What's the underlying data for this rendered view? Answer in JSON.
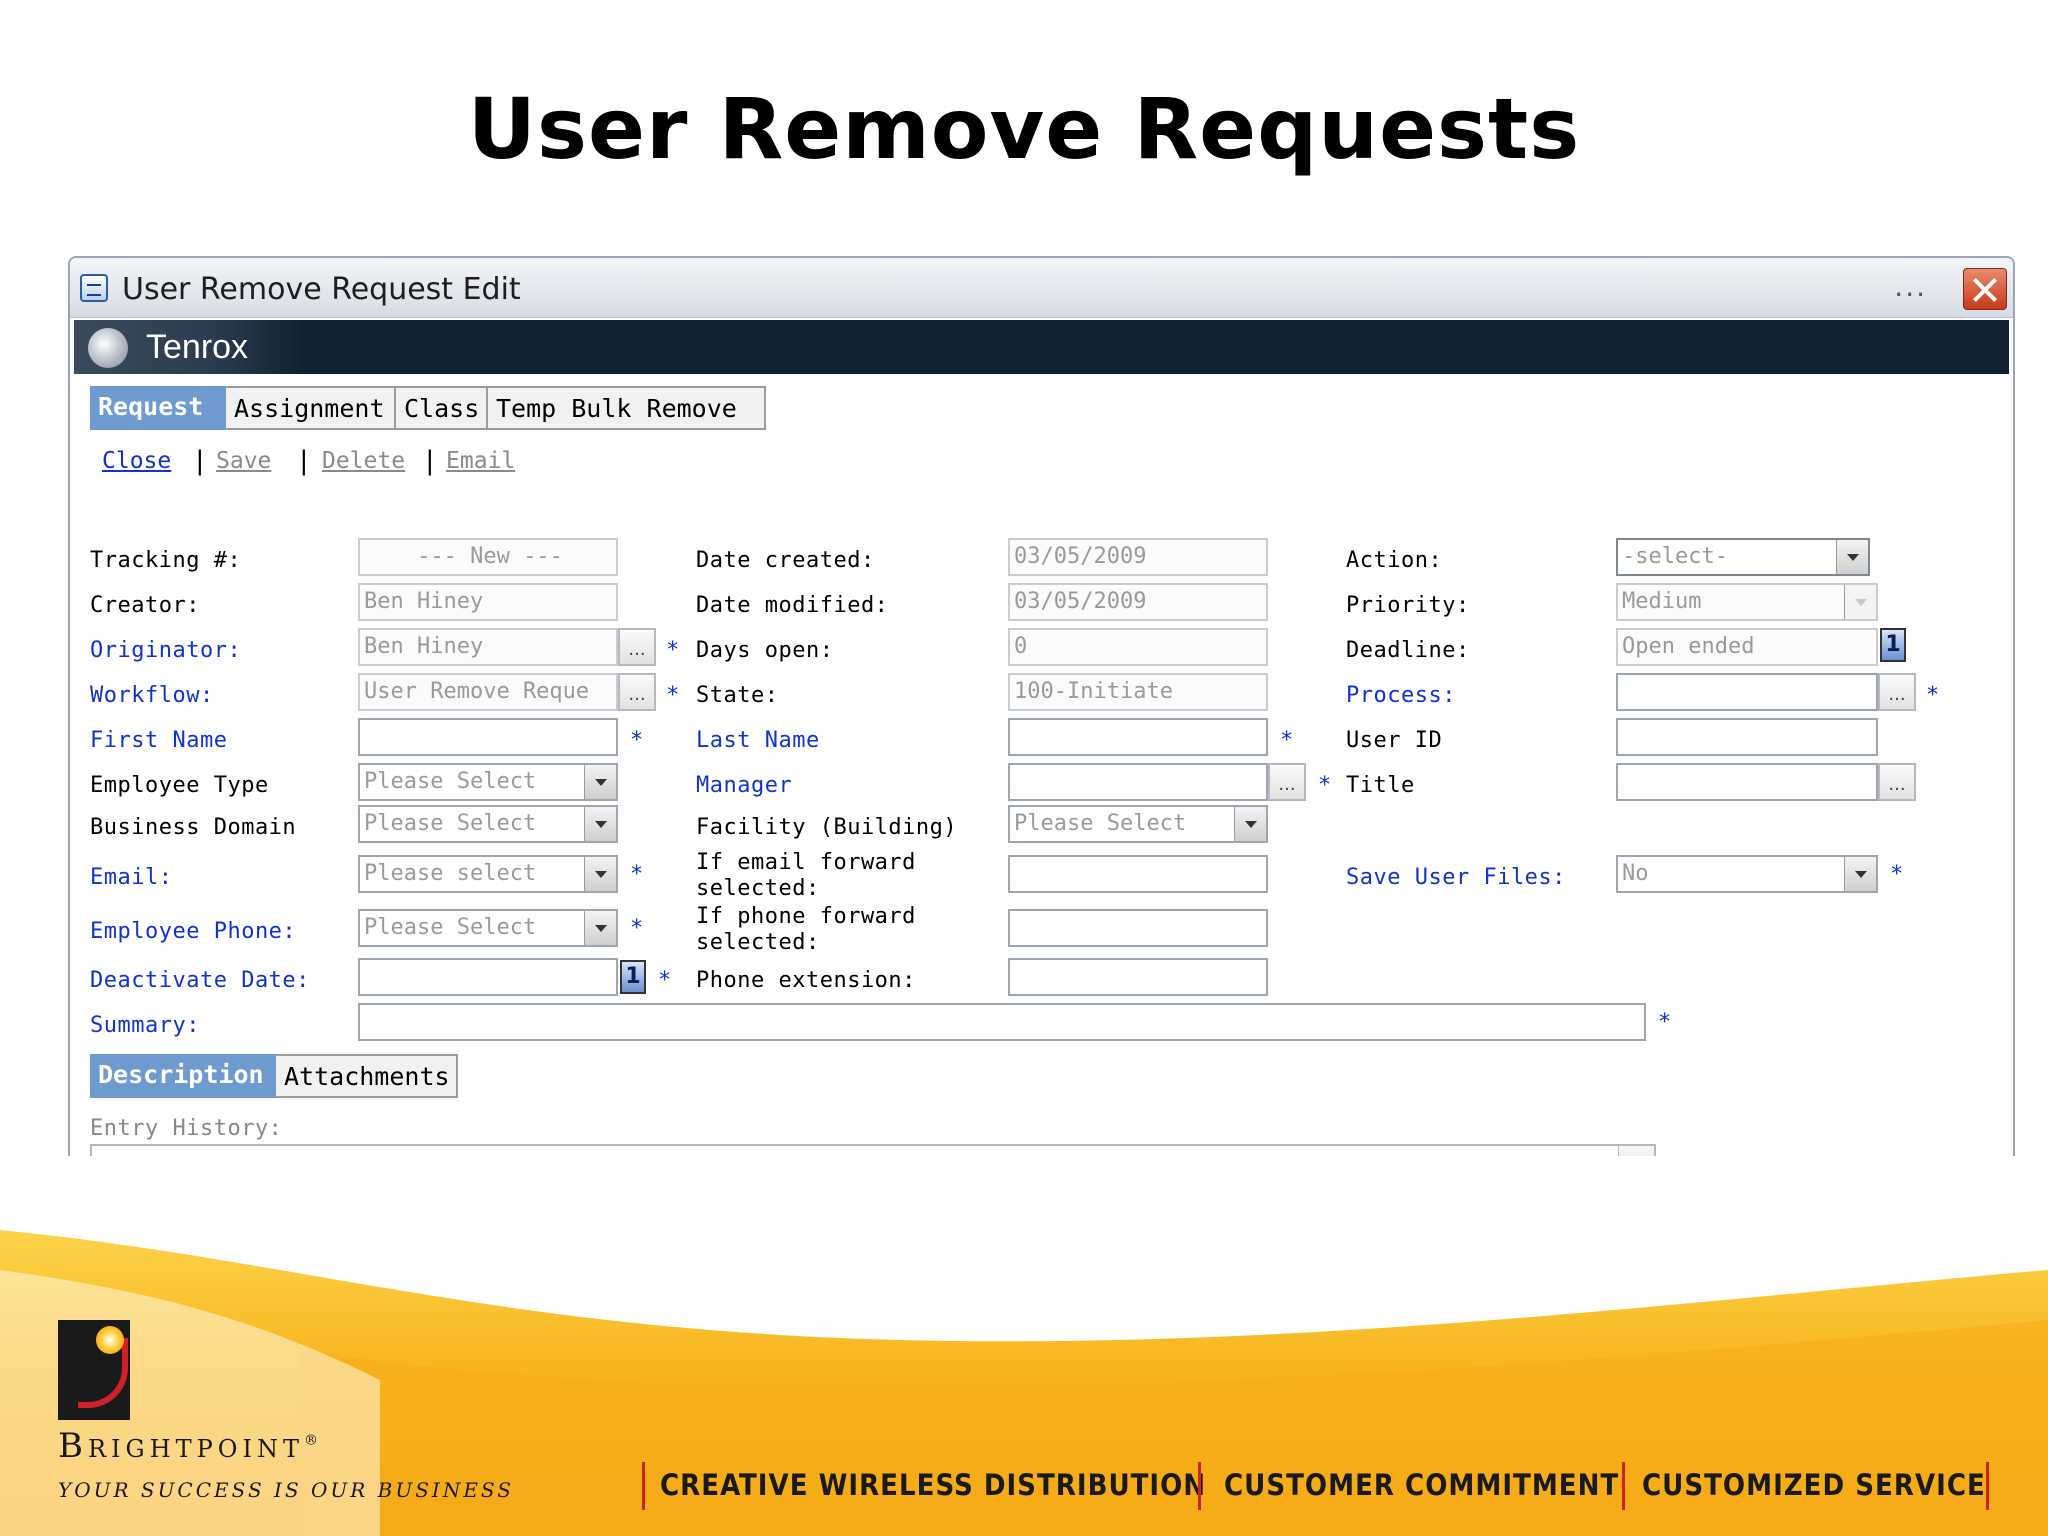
{
  "slide": {
    "title": "User Remove Requests"
  },
  "window": {
    "title": "User Remove Request Edit",
    "dots": "...",
    "brand": "Tenrox"
  },
  "tabs": [
    "Request",
    "Assignment",
    "Class",
    "Temp Bulk Remove"
  ],
  "commands": [
    "Close",
    "Save",
    "Delete",
    "Email"
  ],
  "form": {
    "tracking": {
      "label": "Tracking #:",
      "value": "--- New ---"
    },
    "creator": {
      "label": "Creator:",
      "value": "Ben Hiney"
    },
    "originator": {
      "label": "Originator:",
      "value": "Ben Hiney"
    },
    "workflow": {
      "label": "Workflow:",
      "value": "User Remove Reque"
    },
    "first_name": {
      "label": "First Name",
      "value": ""
    },
    "employee_type": {
      "label": "Employee Type",
      "value": "Please Select"
    },
    "business_domain": {
      "label": "Business Domain",
      "value": "Please Select"
    },
    "email": {
      "label": "Email:",
      "value": "Please select"
    },
    "employee_phone": {
      "label": "Employee Phone:",
      "value": "Please Select"
    },
    "deactivate_date": {
      "label": "Deactivate Date:",
      "value": ""
    },
    "summary": {
      "label": "Summary:",
      "value": ""
    },
    "date_created": {
      "label": "Date created:",
      "value": "03/05/2009"
    },
    "date_modified": {
      "label": "Date modified:",
      "value": "03/05/2009"
    },
    "days_open": {
      "label": "Days open:",
      "value": "0"
    },
    "state": {
      "label": "State:",
      "value": "100-Initiate"
    },
    "last_name": {
      "label": "Last Name",
      "value": ""
    },
    "manager": {
      "label": "Manager",
      "value": ""
    },
    "facility": {
      "label": "Facility (Building)",
      "value": "Please Select"
    },
    "email_forward": {
      "label_line1": "If email forward",
      "label_line2": "selected:",
      "value": ""
    },
    "phone_forward": {
      "label_line1": "If phone forward",
      "label_line2": "selected:",
      "value": ""
    },
    "phone_extension": {
      "label": "Phone extension:",
      "value": ""
    },
    "action": {
      "label": "Action:",
      "value": "-select-"
    },
    "priority": {
      "label": "Priority:",
      "value": "Medium"
    },
    "deadline": {
      "label": "Deadline:",
      "value": "Open ended"
    },
    "process": {
      "label": "Process:",
      "value": ""
    },
    "user_id": {
      "label": "User ID",
      "value": ""
    },
    "title": {
      "label": "Title",
      "value": ""
    },
    "save_user_files": {
      "label": "Save User Files:",
      "value": "No"
    },
    "required_mark": "*",
    "ellipsis": "...",
    "calendar_glyph": "1"
  },
  "subtabs": [
    "Description",
    "Attachments"
  ],
  "history": {
    "label": "Entry History:"
  },
  "footer": {
    "brand": "Brightpoint",
    "registered": "®",
    "tagline": "Your success is our business",
    "mottos": [
      "CREATIVE WIRELESS DISTRIBUTION",
      "CUSTOMER COMMITMENT",
      "CUSTOMIZED SERVICE"
    ]
  },
  "colors": {
    "tab_active": "#6e9ad0",
    "link": "#1133cc",
    "brand_bar": "#102231",
    "footer_gold": "#f7b21a",
    "accent_red": "#d0202a"
  }
}
